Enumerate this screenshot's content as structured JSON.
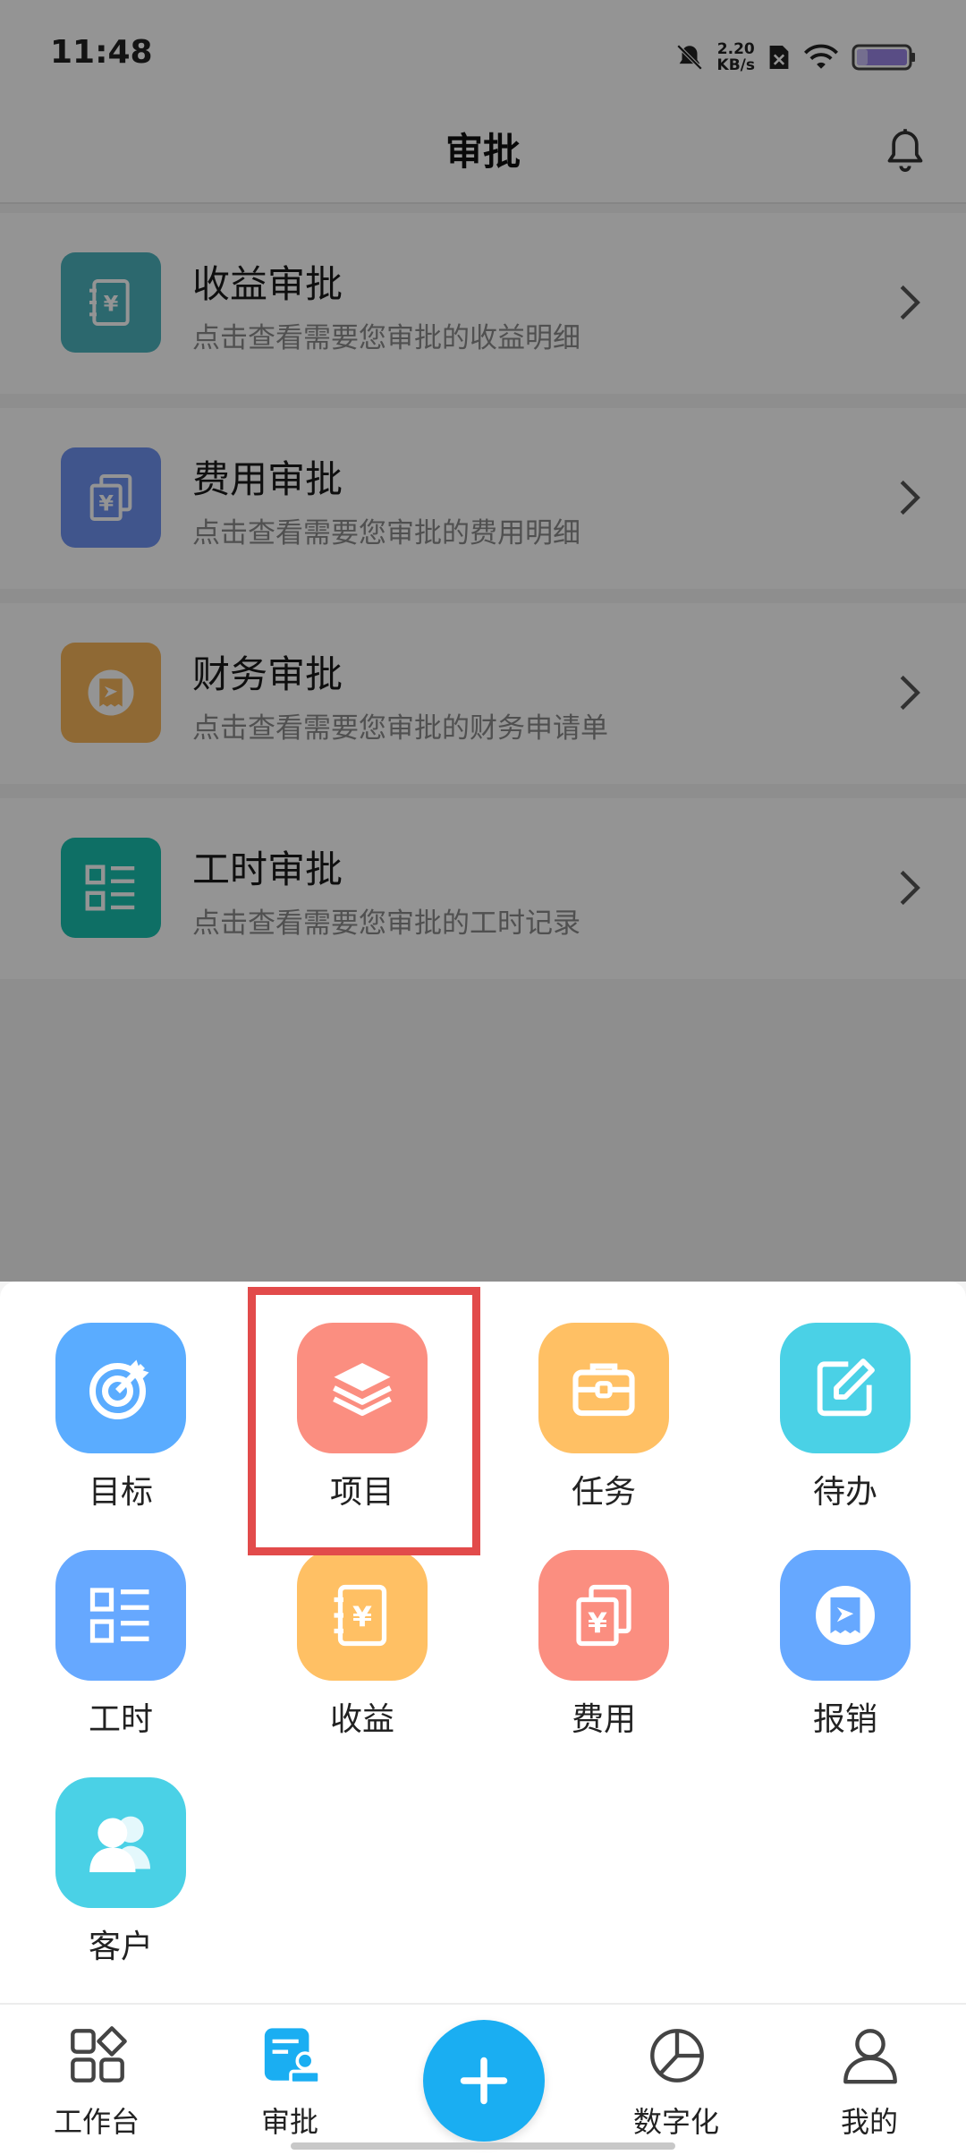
{
  "status_bar": {
    "time": "11:48",
    "net_speed_value": "2.20",
    "net_speed_unit": "KB/s",
    "icons": [
      "mute-bell-icon",
      "sim-off-icon",
      "wifi-icon",
      "battery-icon"
    ]
  },
  "header": {
    "title": "审批",
    "right_icon": "bell-icon"
  },
  "approvals": [
    {
      "title": "收益审批",
      "desc": "点击查看需要您审批的收益明细",
      "icon": "yuan-ledger-icon",
      "color": "#4db3bd"
    },
    {
      "title": "费用审批",
      "desc": "点击查看需要您审批的费用明细",
      "icon": "yuan-stack-icon",
      "color": "#6f93f2"
    },
    {
      "title": "财务审批",
      "desc": "点击查看需要您审批的财务申请单",
      "icon": "receipt-icon",
      "color": "#f6b55a"
    },
    {
      "title": "工时审批",
      "desc": "点击查看需要您审批的工时记录",
      "icon": "list-icon",
      "color": "#19bfae"
    }
  ],
  "sheet": {
    "items": [
      {
        "label": "目标",
        "icon": "target-icon",
        "color": "#5aacff"
      },
      {
        "label": "项目",
        "icon": "layers-icon",
        "color": "#fb8e80"
      },
      {
        "label": "任务",
        "icon": "briefcase-icon",
        "color": "#ffc064"
      },
      {
        "label": "待办",
        "icon": "edit-icon",
        "color": "#4ad1e6"
      },
      {
        "label": "工时",
        "icon": "list-icon",
        "color": "#66a8ff"
      },
      {
        "label": "收益",
        "icon": "yuan-ledger-icon",
        "color": "#ffc064"
      },
      {
        "label": "费用",
        "icon": "yuan-stack-icon",
        "color": "#fb8e80"
      },
      {
        "label": "报销",
        "icon": "receipt-icon",
        "color": "#66a8ff"
      },
      {
        "label": "客户",
        "icon": "users-icon",
        "color": "#4ad1e6"
      }
    ],
    "highlighted": "项目"
  },
  "tabbar": {
    "tabs": [
      {
        "label": "工作台",
        "icon": "grid-icon"
      },
      {
        "label": "审批",
        "icon": "approval-icon",
        "active": true
      },
      {
        "label": "数字化",
        "icon": "pie-icon"
      },
      {
        "label": "我的",
        "icon": "user-icon"
      }
    ],
    "fab_icon": "plus-icon",
    "accent": "#1aaef2"
  }
}
